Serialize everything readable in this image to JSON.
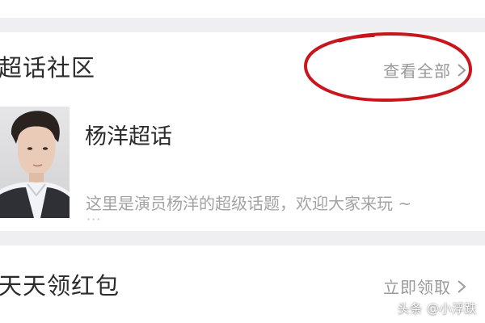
{
  "super_topic_section": {
    "title": "超话社区",
    "see_all_label": "查看全部",
    "see_all_icon": "chevron-right-icon",
    "topic": {
      "name": "杨洋超话",
      "description": "这里是演员杨洋的超级话题，欢迎大家来玩 ~",
      "ellipsis": "···",
      "avatar_icon": "portrait-photo"
    }
  },
  "red_packet_section": {
    "title": "天天领红包",
    "action_label": "立即领取",
    "action_icon": "chevron-right-icon"
  },
  "annotation": {
    "shape": "hand-drawn ellipse",
    "color": "#c8161d"
  },
  "watermark": "头条 @小浮跌"
}
